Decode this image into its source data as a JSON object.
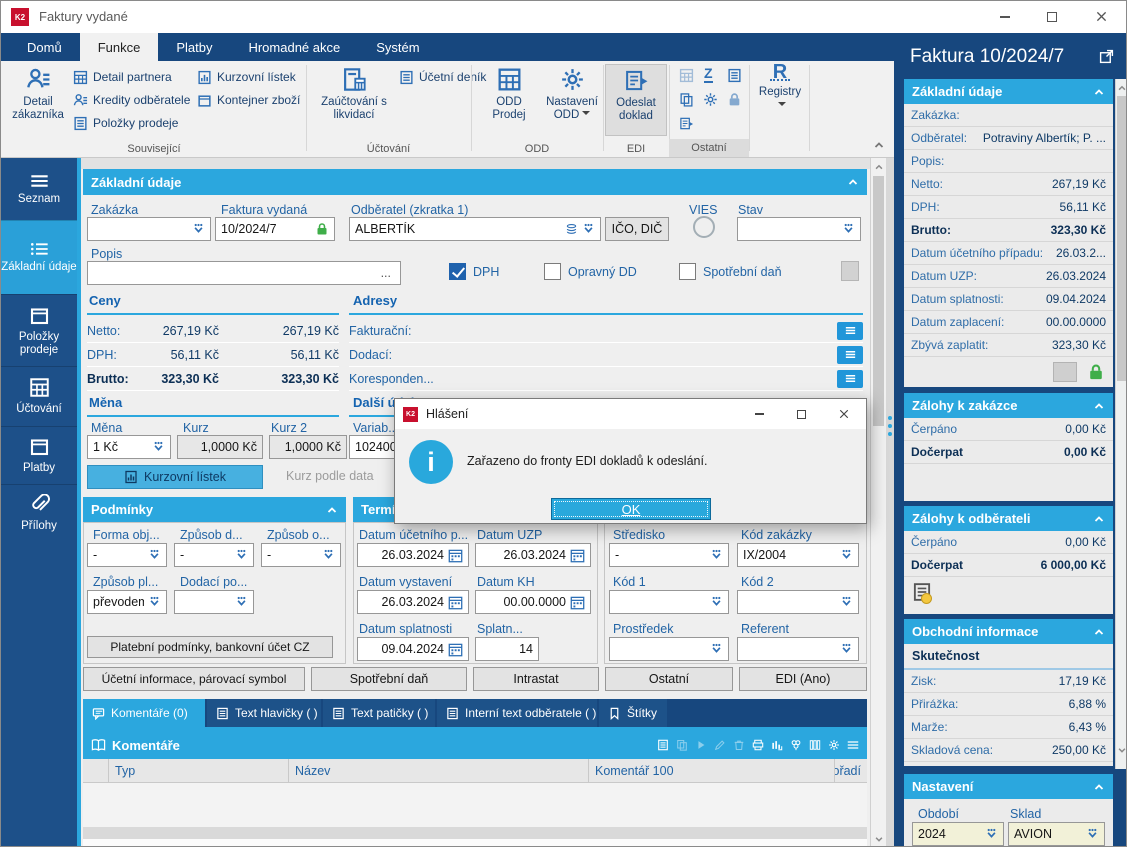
{
  "colors": {
    "accent": "#2ba7de",
    "navy": "#17477e",
    "locked_green": "#3fae49",
    "brand_red": "#c8102e"
  },
  "icons": {
    "k2": "K2"
  },
  "window": {
    "title": "Faktury vydané"
  },
  "tabs": [
    "Domů",
    "Funkce",
    "Platby",
    "Hromadné akce",
    "Systém"
  ],
  "ribbon": {
    "detail_zakaznika": "Detail zákazníka",
    "detail_partnera": "Detail partnera",
    "kredity": "Kredity odběratele",
    "polozky_prodeje": "Položky prodeje",
    "kurzovni_listek": "Kurzovní lístek",
    "kontejner_zbozi": "Kontejner zboží",
    "zauctovani": "Zaúčtování s likvidací",
    "ucetni_denik": "Účetní deník",
    "odd_prodej": "ODD Prodej",
    "nastaveni_odd": "Nastavení ODD",
    "odeslat_doklad": "Odeslat doklad",
    "registry": "Registry",
    "g_souvisejici": "Související",
    "g_uctovani": "Účtování",
    "g_odd": "ODD",
    "g_edi": "EDI",
    "g_ostatni": "Ostatní",
    "glyph_z": "Z",
    "glyph_r": "R",
    "glyph_dollar": "$"
  },
  "sidebar": [
    "Seznam",
    "Základní údaje",
    "Položky prodeje",
    "Účtování",
    "Platby",
    "Přílohy"
  ],
  "form": {
    "section": "Základní údaje",
    "zakazka": "Zakázka",
    "faktura_l": "Faktura vydaná",
    "faktura_v": "10/2024/7",
    "odberatel_l": "Odběratel (zkratka 1)",
    "odberatel_v": "ALBERTÍK",
    "ico_dic": "IČO, DIČ",
    "vies": "VIES",
    "stav": "Stav",
    "popis": "Popis",
    "more": "...",
    "cb_dph": "DPH",
    "cb_oprav": "Opravný DD",
    "cb_spotr": "Spotřební daň",
    "ceny": {
      "t": "Ceny",
      "r": [
        [
          "Netto:",
          "267,19 Kč",
          "267,19 Kč"
        ],
        [
          "DPH:",
          "56,11 Kč",
          "56,11 Kč"
        ],
        [
          "Brutto:",
          "323,30 Kč",
          "323,30 Kč"
        ]
      ]
    },
    "adresy": {
      "t": "Adresy",
      "r": [
        "Fakturační:",
        "Dodací:",
        "Koresponden..."
      ]
    },
    "mena": {
      "t": "Měna",
      "l1": "Měna",
      "v1": "1 Kč",
      "l2": "Kurz",
      "v2": "1,0000 Kč",
      "l3": "Kurz 2",
      "v3": "1,0000 Kč",
      "btn": "Kurzovní lístek",
      "link": "Kurz podle data"
    },
    "dalsi": {
      "t": "Další údaje",
      "l": "Variab...",
      "v": "102400"
    },
    "podminky": {
      "t": "Podmínky",
      "l1": "Forma obj...",
      "v1": "-",
      "l2": "Způsob d...",
      "v2": "-",
      "l3": "Způsob o...",
      "v3": "-",
      "l4": "Způsob pl...",
      "v4": "převodem",
      "l5": "Dodací po...",
      "v5": "",
      "btn": "Platební podmínky, bankovní účet CZ"
    },
    "terminy": {
      "t": "Termíny",
      "l1": "Datum účetního p...",
      "v1": "26.03.2024",
      "l2": "Datum UZP",
      "v2": "26.03.2024",
      "l3": "Datum vystavení",
      "v3": "26.03.2024",
      "l4": "Datum KH",
      "v4": "00.00.0000",
      "l5": "Datum splatnosti",
      "v5": "09.04.2024",
      "l6": "Splatn...",
      "v6": "14"
    },
    "kody": {
      "l1": "Středisko",
      "v1": "-",
      "l2": "Kód zakázky",
      "v2": "IX/2004",
      "l3": "Kód 1",
      "v3": "",
      "l4": "Kód 2",
      "v4": "",
      "l5": "Prostředek",
      "v5": "",
      "l6": "Referent",
      "v6": ""
    },
    "btns": [
      "Účetní informace, párovací symbol",
      "Spotřební daň",
      "Intrastat",
      "Ostatní",
      "EDI (Ano)"
    ],
    "tabs": [
      "Komentáře (0)",
      "Text hlavičky ( )",
      "Text patičky ( )",
      "Interní text odběratele ( )",
      "Štítky"
    ],
    "kom": {
      "t": "Komentáře",
      "cols": [
        "Typ",
        "Název",
        "Komentář 100",
        "Pořadí"
      ]
    }
  },
  "dialog": {
    "title": "Hlášení",
    "msg": "Zařazeno do fronty EDI dokladů k odeslání.",
    "ok": "OK",
    "i": "i"
  },
  "panel": {
    "title": "Faktura 10/2024/7",
    "c1": {
      "t": "Základní údaje",
      "r": [
        [
          "Zakázka:",
          ""
        ],
        [
          "Odběratel:",
          "Potraviny Albertík; P. ..."
        ],
        [
          "Popis:",
          ""
        ],
        [
          "Netto:",
          "267,19 Kč"
        ],
        [
          "DPH:",
          "56,11 Kč"
        ],
        [
          "Brutto:",
          "323,30 Kč"
        ],
        [
          "Datum účetního případu:",
          "26.03.2..."
        ],
        [
          "Datum UZP:",
          "26.03.2024"
        ],
        [
          "Datum splatnosti:",
          "09.04.2024"
        ],
        [
          "Datum zaplacení:",
          "00.00.0000"
        ],
        [
          "Zbývá zaplatit:",
          "323,30 Kč"
        ]
      ]
    },
    "c2": {
      "t": "Zálohy k zakázce",
      "r": [
        [
          "Čerpáno",
          "0,00 Kč"
        ],
        [
          "Dočerpat",
          "0,00 Kč"
        ]
      ]
    },
    "c3": {
      "t": "Zálohy k odběrateli",
      "r": [
        [
          "Čerpáno",
          "0,00 Kč"
        ],
        [
          "Dočerpat",
          "6 000,00 Kč"
        ]
      ]
    },
    "c4": {
      "t": "Obchodní informace",
      "sub": "Skutečnost",
      "r": [
        [
          "Zisk:",
          "17,19 Kč"
        ],
        [
          "Přirážka:",
          "6,88 %"
        ],
        [
          "Marže:",
          "6,43 %"
        ],
        [
          "Skladová cena:",
          "250,00 Kč"
        ]
      ]
    },
    "c5": {
      "t": "Nastavení",
      "l1": "Období",
      "v1": "2024",
      "l2": "Sklad",
      "v2": "AVION"
    }
  }
}
